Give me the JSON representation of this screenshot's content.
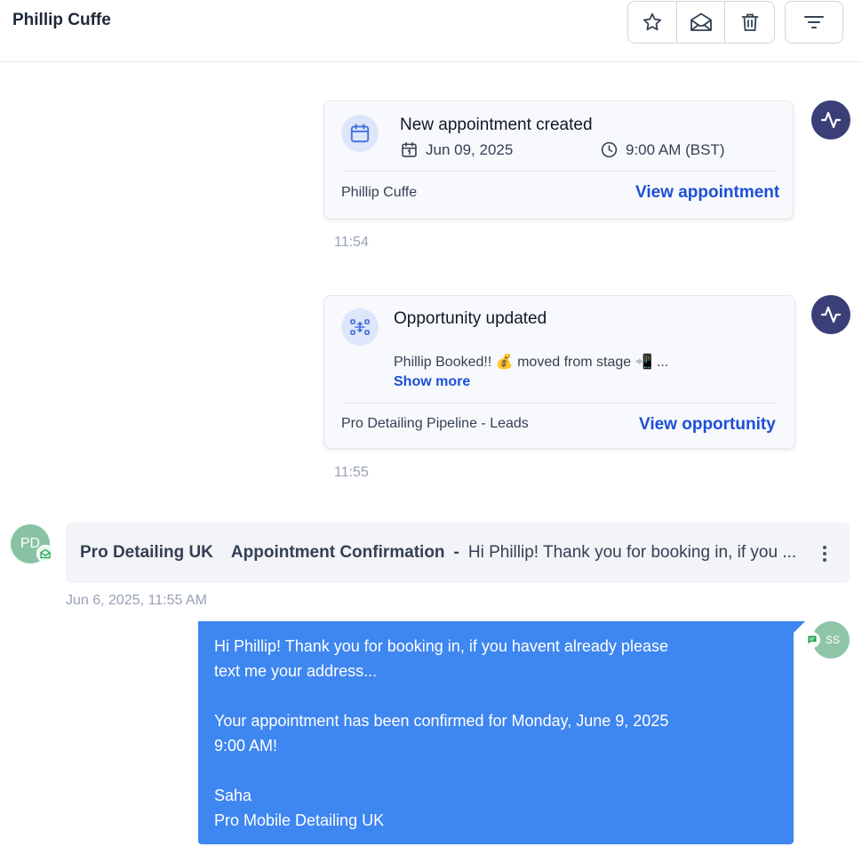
{
  "header": {
    "contact_name": "Phillip Cuffe",
    "actions": [
      "star-icon",
      "mail-open-icon",
      "trash-icon"
    ],
    "filter_icon": "filter-lines-icon"
  },
  "activities": [
    {
      "title": "New appointment created",
      "date": "Jun 09, 2025",
      "time": "9:00 AM (BST)",
      "footer": "Phillip Cuffe",
      "link": "View appointment",
      "timestamp": "11:54",
      "icon": "calendar-icon"
    },
    {
      "title": "Opportunity updated",
      "summary": "Phillip Booked!! 💰 moved from stage 📲 ...",
      "show_more": "Show more",
      "footer": "Pro Detailing Pipeline - Leads",
      "link": "View opportunity",
      "timestamp": "11:55",
      "icon": "pipeline-icon"
    }
  ],
  "email": {
    "avatar_initials": "PD",
    "sender": "Pro Detailing UK",
    "subject": "Appointment Confirmation",
    "separator": "-",
    "preview": "Hi Phillip! Thank you for booking in, if you ...",
    "timestamp": "Jun 6, 2025, 11:55 AM"
  },
  "message": {
    "avatar_initials": "SS",
    "lines": [
      "Hi Phillip! Thank you for booking in, if you havent already please",
      "text me your address...",
      "",
      "Your appointment has been confirmed for Monday, June 9, 2025",
      "9:00 AM!",
      "",
      "Saha",
      "Pro Mobile Detailing UK"
    ]
  },
  "colors": {
    "accent_blue": "#1d4fd8",
    "bubble_blue": "#3e86f0",
    "activity_avatar": "#3b3f77",
    "green_avatar": "#89c2a5"
  }
}
